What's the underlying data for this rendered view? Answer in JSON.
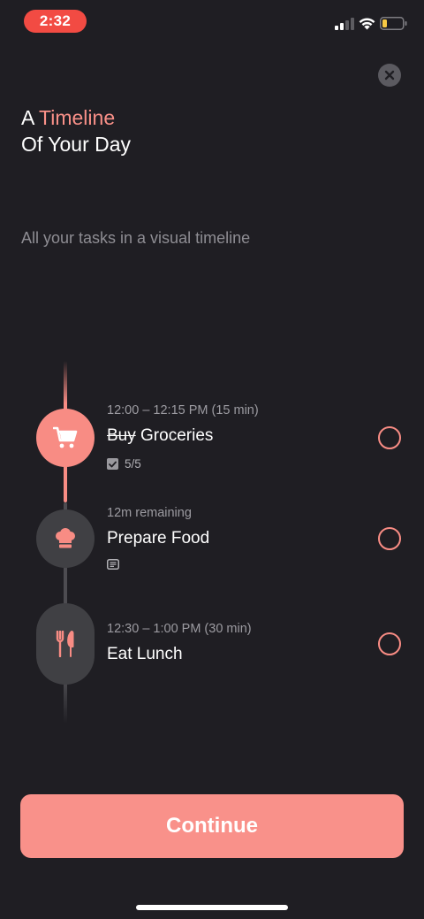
{
  "status_bar": {
    "time": "2:32"
  },
  "header": {
    "title_prefix": "A ",
    "title_accent": "Timeline",
    "title_line2": "Of Your Day",
    "subtitle": "All your tasks in a visual timeline"
  },
  "tasks": [
    {
      "time": "12:00 – 12:15 PM (15 min)",
      "title_struck": "Buy",
      "title_rest": " Groceries",
      "subtasks": "5/5",
      "icon": "cart-icon"
    },
    {
      "time": "12m remaining",
      "title": "Prepare Food",
      "icon": "chef-hat-icon",
      "has_note": true
    },
    {
      "time": "12:30 – 1:00 PM (30 min)",
      "title": "Eat Lunch",
      "icon": "fork-knife-icon"
    }
  ],
  "footer": {
    "continue_label": "Continue"
  },
  "colors": {
    "background": "#1f1e23",
    "accent": "#f88c84",
    "status_time": "#f24b43",
    "node_inactive": "#404044"
  }
}
